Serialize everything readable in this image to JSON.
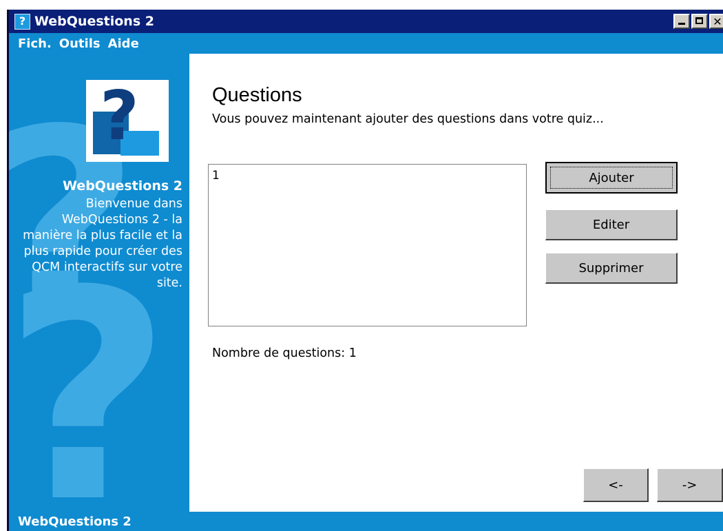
{
  "window": {
    "title": "WebQuestions 2",
    "app_icon_glyph": "?",
    "controls": [
      "minimize-icon",
      "maximize-icon",
      "close-icon"
    ],
    "close_glyph": "✕"
  },
  "menu": {
    "items": [
      {
        "label": "Fich."
      },
      {
        "label": "Outils"
      },
      {
        "label": "Aide"
      }
    ]
  },
  "sidebar": {
    "logo_glyph": "?",
    "title": "WebQuestions 2",
    "description": "Bienvenue dans WebQuestions 2 - la manière la plus facile et la plus rapide pour créer des QCM interactifs sur votre site."
  },
  "main": {
    "heading": "Questions",
    "instructions": "Vous pouvez maintenant ajouter des questions dans votre quiz...",
    "question_list": [
      "1"
    ],
    "buttons": {
      "add": "Ajouter",
      "edit": "Editer",
      "delete": "Supprimer"
    },
    "count_text": "Nombre de questions: 1",
    "nav": {
      "back": "<-",
      "next": "->"
    }
  },
  "status": {
    "text": "WebQuestions 2"
  },
  "colors": {
    "titlebar": "#0a1f78",
    "panel_blue": "#0f8bd0",
    "button_face": "#c8c8c8"
  }
}
